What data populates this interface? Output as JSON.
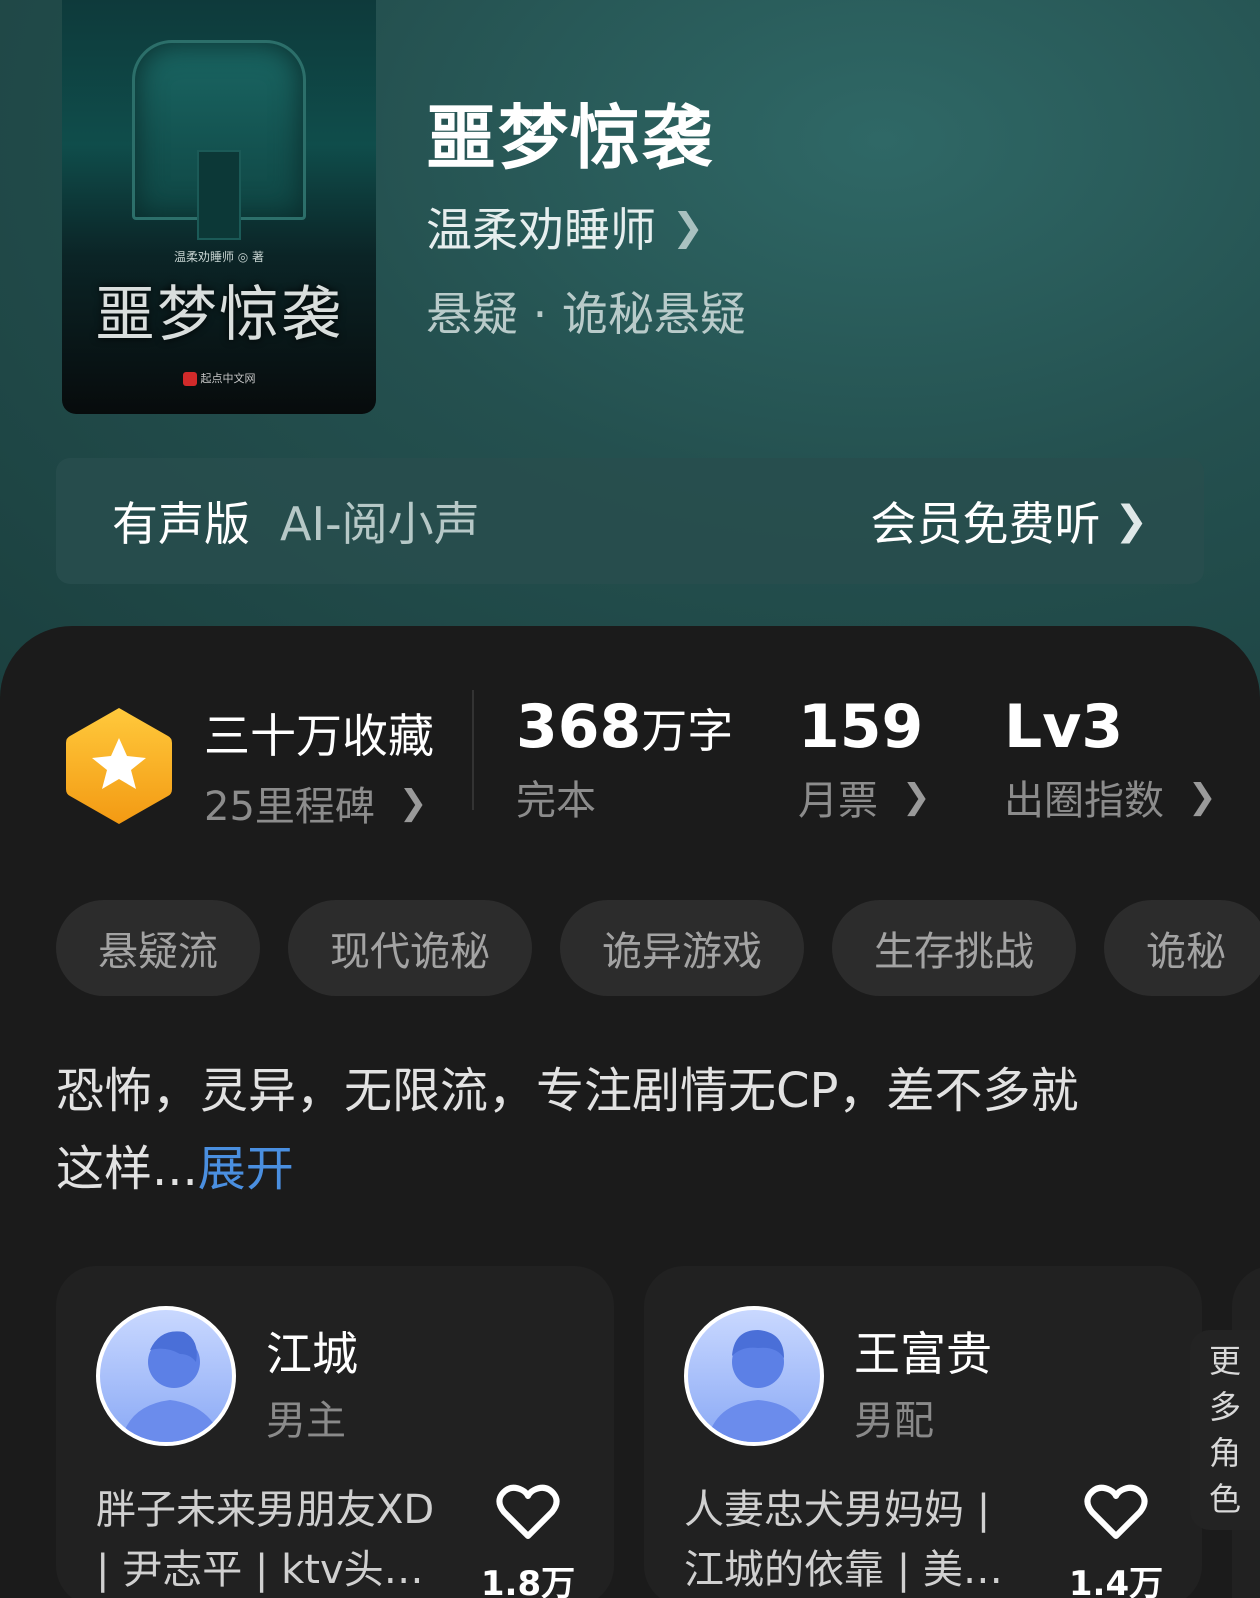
{
  "book": {
    "title": "噩梦惊袭",
    "author": "温柔劝睡师",
    "genre": "悬疑 · 诡秘悬疑",
    "cover": {
      "title": "噩梦惊袭",
      "author_line": "温柔劝睡师 ◎ 著",
      "publisher": "起点中文网"
    }
  },
  "audio": {
    "label": "有声版",
    "voice": "AI-阅小声",
    "cta": "会员免费听"
  },
  "stats": {
    "collection": "三十万收藏",
    "milestone": "25里程碑",
    "words_number": "368",
    "words_unit": "万字",
    "status": "完本",
    "monthly_votes": "159",
    "monthly_votes_label": "月票",
    "level": "Lv3",
    "level_label": "出圈指数"
  },
  "tags": [
    "悬疑流",
    "现代诡秘",
    "诡异游戏",
    "生存挑战",
    "诡秘"
  ],
  "description": {
    "line1": "恐怖，灵异，无限流，专注剧情无CP，差不多就",
    "line2": "这样...",
    "expand": "展开"
  },
  "characters": [
    {
      "name": "江城",
      "role": "男主",
      "desc_line1": "胖子未来男朋友XD",
      "desc_line2": "| 尹志平 | ktv头…",
      "likes": "1.8万"
    },
    {
      "name": "王富贵",
      "role": "男配",
      "desc_line1": "人妻忠犬男妈妈 |",
      "desc_line2": "江城的依靠 | 美…",
      "likes": "1.4万"
    }
  ],
  "more_roles": [
    "更",
    "多",
    "角",
    "色"
  ],
  "colors": {
    "hero_bg": "#24504f",
    "panel_bg": "#1b1b1b",
    "badge": "#f5a623",
    "expand_link": "#4a8fe0"
  }
}
